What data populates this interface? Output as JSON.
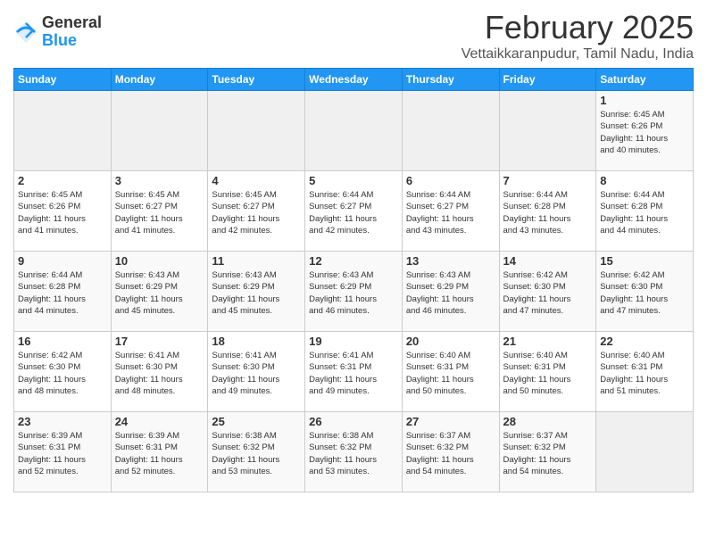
{
  "header": {
    "logo_general": "General",
    "logo_blue": "Blue",
    "month_title": "February 2025",
    "location": "Vettaikkaranpudur, Tamil Nadu, India"
  },
  "days_of_week": [
    "Sunday",
    "Monday",
    "Tuesday",
    "Wednesday",
    "Thursday",
    "Friday",
    "Saturday"
  ],
  "weeks": [
    [
      {
        "day": "",
        "info": ""
      },
      {
        "day": "",
        "info": ""
      },
      {
        "day": "",
        "info": ""
      },
      {
        "day": "",
        "info": ""
      },
      {
        "day": "",
        "info": ""
      },
      {
        "day": "",
        "info": ""
      },
      {
        "day": "1",
        "info": "Sunrise: 6:45 AM\nSunset: 6:26 PM\nDaylight: 11 hours\nand 40 minutes."
      }
    ],
    [
      {
        "day": "2",
        "info": "Sunrise: 6:45 AM\nSunset: 6:26 PM\nDaylight: 11 hours\nand 41 minutes."
      },
      {
        "day": "3",
        "info": "Sunrise: 6:45 AM\nSunset: 6:27 PM\nDaylight: 11 hours\nand 41 minutes."
      },
      {
        "day": "4",
        "info": "Sunrise: 6:45 AM\nSunset: 6:27 PM\nDaylight: 11 hours\nand 42 minutes."
      },
      {
        "day": "5",
        "info": "Sunrise: 6:44 AM\nSunset: 6:27 PM\nDaylight: 11 hours\nand 42 minutes."
      },
      {
        "day": "6",
        "info": "Sunrise: 6:44 AM\nSunset: 6:27 PM\nDaylight: 11 hours\nand 43 minutes."
      },
      {
        "day": "7",
        "info": "Sunrise: 6:44 AM\nSunset: 6:28 PM\nDaylight: 11 hours\nand 43 minutes."
      },
      {
        "day": "8",
        "info": "Sunrise: 6:44 AM\nSunset: 6:28 PM\nDaylight: 11 hours\nand 44 minutes."
      }
    ],
    [
      {
        "day": "9",
        "info": "Sunrise: 6:44 AM\nSunset: 6:28 PM\nDaylight: 11 hours\nand 44 minutes."
      },
      {
        "day": "10",
        "info": "Sunrise: 6:43 AM\nSunset: 6:29 PM\nDaylight: 11 hours\nand 45 minutes."
      },
      {
        "day": "11",
        "info": "Sunrise: 6:43 AM\nSunset: 6:29 PM\nDaylight: 11 hours\nand 45 minutes."
      },
      {
        "day": "12",
        "info": "Sunrise: 6:43 AM\nSunset: 6:29 PM\nDaylight: 11 hours\nand 46 minutes."
      },
      {
        "day": "13",
        "info": "Sunrise: 6:43 AM\nSunset: 6:29 PM\nDaylight: 11 hours\nand 46 minutes."
      },
      {
        "day": "14",
        "info": "Sunrise: 6:42 AM\nSunset: 6:30 PM\nDaylight: 11 hours\nand 47 minutes."
      },
      {
        "day": "15",
        "info": "Sunrise: 6:42 AM\nSunset: 6:30 PM\nDaylight: 11 hours\nand 47 minutes."
      }
    ],
    [
      {
        "day": "16",
        "info": "Sunrise: 6:42 AM\nSunset: 6:30 PM\nDaylight: 11 hours\nand 48 minutes."
      },
      {
        "day": "17",
        "info": "Sunrise: 6:41 AM\nSunset: 6:30 PM\nDaylight: 11 hours\nand 48 minutes."
      },
      {
        "day": "18",
        "info": "Sunrise: 6:41 AM\nSunset: 6:30 PM\nDaylight: 11 hours\nand 49 minutes."
      },
      {
        "day": "19",
        "info": "Sunrise: 6:41 AM\nSunset: 6:31 PM\nDaylight: 11 hours\nand 49 minutes."
      },
      {
        "day": "20",
        "info": "Sunrise: 6:40 AM\nSunset: 6:31 PM\nDaylight: 11 hours\nand 50 minutes."
      },
      {
        "day": "21",
        "info": "Sunrise: 6:40 AM\nSunset: 6:31 PM\nDaylight: 11 hours\nand 50 minutes."
      },
      {
        "day": "22",
        "info": "Sunrise: 6:40 AM\nSunset: 6:31 PM\nDaylight: 11 hours\nand 51 minutes."
      }
    ],
    [
      {
        "day": "23",
        "info": "Sunrise: 6:39 AM\nSunset: 6:31 PM\nDaylight: 11 hours\nand 52 minutes."
      },
      {
        "day": "24",
        "info": "Sunrise: 6:39 AM\nSunset: 6:31 PM\nDaylight: 11 hours\nand 52 minutes."
      },
      {
        "day": "25",
        "info": "Sunrise: 6:38 AM\nSunset: 6:32 PM\nDaylight: 11 hours\nand 53 minutes."
      },
      {
        "day": "26",
        "info": "Sunrise: 6:38 AM\nSunset: 6:32 PM\nDaylight: 11 hours\nand 53 minutes."
      },
      {
        "day": "27",
        "info": "Sunrise: 6:37 AM\nSunset: 6:32 PM\nDaylight: 11 hours\nand 54 minutes."
      },
      {
        "day": "28",
        "info": "Sunrise: 6:37 AM\nSunset: 6:32 PM\nDaylight: 11 hours\nand 54 minutes."
      },
      {
        "day": "",
        "info": ""
      }
    ]
  ]
}
